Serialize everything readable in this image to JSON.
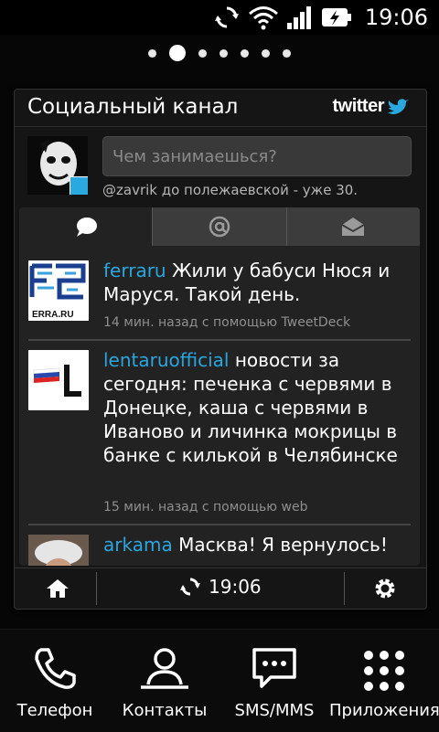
{
  "status_bar": {
    "time": "19:06",
    "icons": [
      "sync-icon",
      "wifi-icon",
      "signal-icon",
      "battery-charging-icon"
    ]
  },
  "home_pager": {
    "pages": 7,
    "active": 2
  },
  "widget": {
    "title": "Социальный канал",
    "brand": "twitter",
    "status_placeholder": "Чем занимаешься?",
    "last_status": "@zavrik до полежаевской - уже 30.",
    "tabs": [
      {
        "icon": "speech-bubble-icon",
        "active": true
      },
      {
        "icon": "at-icon",
        "active": false
      },
      {
        "icon": "envelope-icon",
        "active": false
      }
    ],
    "tweets": [
      {
        "author": "ferraru",
        "text": "Жили у бабуси Нюся и Маруся. Такой день.",
        "meta": "14 мин. назад с помощью TweetDeck"
      },
      {
        "author": "lentaruofficial",
        "text": "новости за сегодня: печенка с червями в Донецке, каша с червями в Иваново и личинка мокрицы в банке с килькой в Челябинске",
        "meta": "15 мин. назад с помощью web"
      },
      {
        "author": "arkama",
        "text": "Масква! Я вернулось!",
        "meta": ""
      }
    ],
    "footer": {
      "refresh_time": "19:06"
    }
  },
  "dock": {
    "items": [
      {
        "label": "Телефон",
        "icon": "phone-icon"
      },
      {
        "label": "Контакты",
        "icon": "contacts-icon"
      },
      {
        "label": "SMS/MMS",
        "icon": "sms-icon"
      },
      {
        "label": "Приложения",
        "icon": "apps-icon"
      }
    ]
  }
}
